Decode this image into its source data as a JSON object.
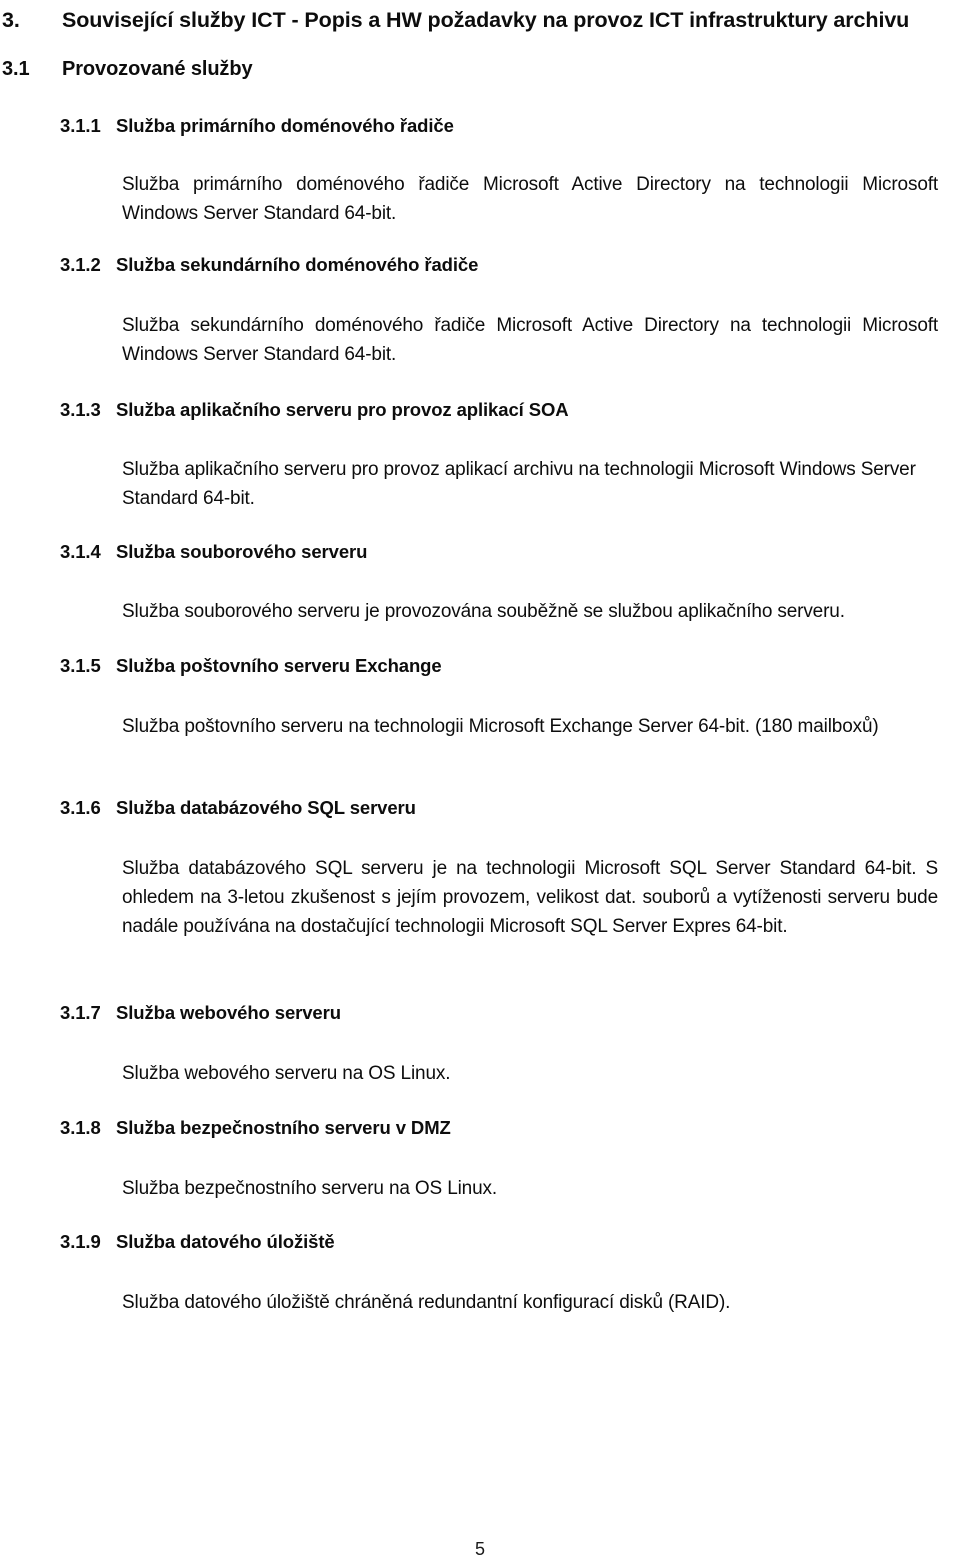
{
  "document": {
    "language": "cs",
    "page_number": "5",
    "text_color": "#0d0d0d",
    "background_color": "#ffffff"
  },
  "section_3": {
    "number": "3.",
    "title": "Související služby ICT - Popis a HW požadavky na provoz ICT infrastruktury archivu"
  },
  "section_3_1": {
    "number": "3.1",
    "title": "Provozované služby"
  },
  "subsections": [
    {
      "number": "3.1.1",
      "title": "Služba primárního doménového řadiče",
      "body": "Služba primárního doménového řadiče Microsoft Active Directory na technologii Microsoft Windows Server Standard 64-bit.",
      "align": "justify"
    },
    {
      "number": "3.1.2",
      "title": "Služba sekundárního doménového řadiče",
      "body": "Služba sekundárního doménového řadiče Microsoft Active Directory na technologii Microsoft Windows Server Standard 64-bit.",
      "align": "justify"
    },
    {
      "number": "3.1.3",
      "title": "Služba aplikačního serveru pro provoz aplikací SOA",
      "body": "Služba aplikačního serveru pro provoz aplikací archivu na technologii Microsoft Windows Server Standard 64-bit.",
      "align": "left"
    },
    {
      "number": "3.1.4",
      "title": "Služba souborového serveru",
      "body": "Služba souborového serveru je provozována souběžně se službou aplikačního serveru.",
      "align": "left"
    },
    {
      "number": "3.1.5",
      "title": "Služba poštovního serveru Exchange",
      "body": "Služba poštovního serveru na technologii Microsoft Exchange Server 64-bit. (180 mailboxů)",
      "align": "justify"
    },
    {
      "number": "3.1.6",
      "title": "Služba databázového SQL serveru",
      "body": "Služba databázového SQL serveru je na technologii Microsoft SQL Server Standard 64-bit. S ohledem na 3-letou zkušenost s jejím provozem, velikost dat. souborů a vytíženosti serveru bude nadále používána na dostačující technologii Microsoft SQL Server Expres 64-bit.",
      "align": "justify"
    },
    {
      "number": "3.1.7",
      "title": "Služba webového serveru",
      "body": "Služba webového serveru na OS Linux.",
      "align": "left"
    },
    {
      "number": "3.1.8",
      "title": "Služba bezpečnostního serveru v DMZ",
      "body": "Služba bezpečnostního serveru na OS Linux.",
      "align": "left"
    },
    {
      "number": "3.1.9",
      "title": "Služba datového úložiště",
      "body": "Služba datového úložiště chráněná redundantní konfigurací disků (RAID).",
      "align": "left"
    }
  ]
}
